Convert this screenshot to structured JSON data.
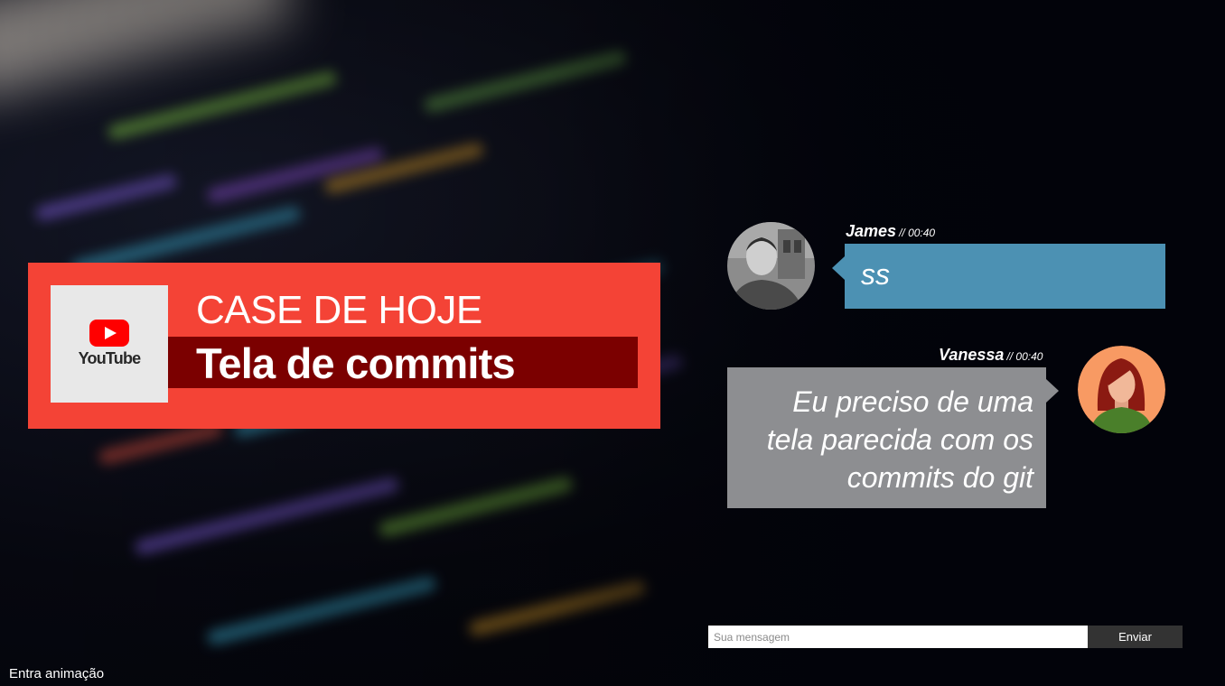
{
  "case": {
    "logo_text": "YouTube",
    "kicker": "CASE DE HOJE",
    "title": "Tela de commits"
  },
  "messages": [
    {
      "author": "James",
      "time": "// 00:40",
      "text": "ss",
      "bubble_color": "#4c91b3"
    },
    {
      "author": "Vanessa",
      "time": "// 00:40",
      "text": "Eu preciso de uma tela parecida com os commits do git",
      "bubble_color": "#8d8e91"
    }
  ],
  "composer": {
    "placeholder": "Sua mensagem",
    "value": "",
    "send_label": "Enviar"
  },
  "footer": {
    "animation_label": "Entra animação"
  },
  "colors": {
    "card": "#f44336",
    "title_bar": "#7b0000",
    "youtube_red": "#ff0000"
  }
}
